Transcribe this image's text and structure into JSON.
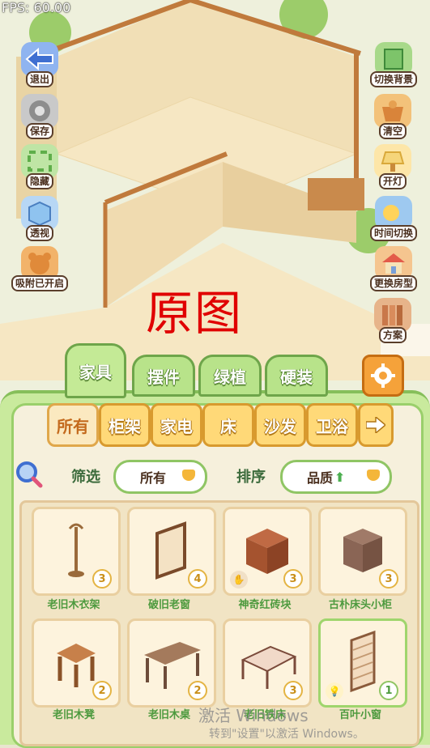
{
  "fps": "FPS: 60.00",
  "watermark_title": "原图",
  "left_buttons": [
    {
      "label": "退出",
      "icon": "exit-arrow-icon"
    },
    {
      "label": "保存",
      "icon": "save-disk-icon"
    },
    {
      "label": "隐藏",
      "icon": "hide-frame-icon"
    },
    {
      "label": "透视",
      "icon": "perspective-cube-icon"
    },
    {
      "label": "吸附已开启",
      "icon": "snap-bear-icon"
    }
  ],
  "right_buttons": [
    {
      "label": "切换背景",
      "icon": "background-switch-icon"
    },
    {
      "label": "清空",
      "icon": "clear-basket-icon"
    },
    {
      "label": "开灯",
      "icon": "lamp-icon"
    },
    {
      "label": "时间切换",
      "icon": "time-switch-icon"
    },
    {
      "label": "更换房型",
      "icon": "house-icon"
    },
    {
      "label": "方案",
      "icon": "plan-books-icon"
    }
  ],
  "category_tabs": [
    "家具",
    "摆件",
    "绿植",
    "硬装"
  ],
  "sub_tabs": [
    "所有",
    "柜架",
    "家电",
    "床",
    "沙发",
    "卫浴"
  ],
  "filter": {
    "label": "筛选",
    "value": "所有"
  },
  "sort": {
    "label": "排序",
    "value": "品质"
  },
  "items": [
    {
      "name": "老旧木衣架",
      "level": "3",
      "icon": "coat-rack-icon"
    },
    {
      "name": "破旧老窗",
      "level": "4",
      "icon": "old-window-icon"
    },
    {
      "name": "神奇红砖块",
      "level": "3",
      "icon": "red-brick-icon"
    },
    {
      "name": "古朴床头小柜",
      "level": "3",
      "icon": "nightstand-icon"
    },
    {
      "name": "老旧木凳",
      "level": "2",
      "icon": "stool-icon"
    },
    {
      "name": "老旧木桌",
      "level": "2",
      "icon": "wood-table-icon"
    },
    {
      "name": "老旧铁床",
      "level": "3",
      "icon": "iron-bed-icon"
    },
    {
      "name": "百叶小窗",
      "level": "1",
      "icon": "shutter-window-icon"
    }
  ],
  "windows_watermark": {
    "line1": "激活 Windows",
    "line2": "转到\"设置\"以激活 Windows。"
  }
}
